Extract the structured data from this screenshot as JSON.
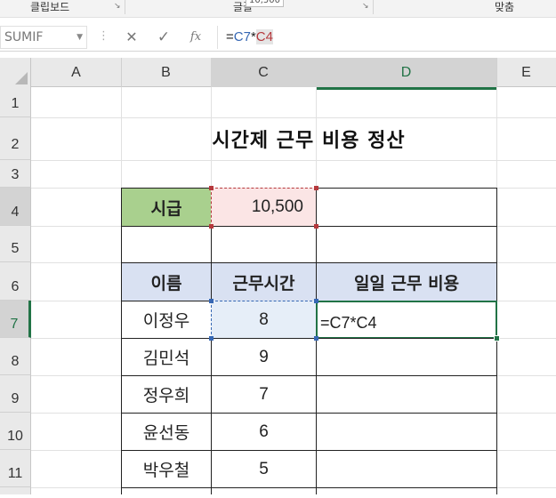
{
  "ribbon": {
    "groups": [
      "클립보드",
      "글꼴",
      "맞춤"
    ],
    "tooltip": "10,500"
  },
  "formula_bar": {
    "name_box": "SUMIF",
    "cancel_icon": "✕",
    "enter_icon": "✓",
    "fx_label": "fx",
    "formula_prefix": "=",
    "formula_ref1": "C7",
    "formula_op": "*",
    "formula_ref2": "C4"
  },
  "columns": [
    "A",
    "B",
    "C",
    "D",
    "E"
  ],
  "rows": [
    "1",
    "2",
    "3",
    "4",
    "5",
    "6",
    "7",
    "8",
    "9",
    "10",
    "11"
  ],
  "sheet": {
    "title": "시간제 근무 비용 정산",
    "wage_label": "시급",
    "wage_value": "10,500",
    "headers": [
      "이름",
      "근무시간",
      "일일 근무 비용"
    ],
    "employees": [
      {
        "name": "이정우",
        "hours": "8",
        "cost": "=C7*C4"
      },
      {
        "name": "김민석",
        "hours": "9",
        "cost": ""
      },
      {
        "name": "정우희",
        "hours": "7",
        "cost": ""
      },
      {
        "name": "윤선동",
        "hours": "6",
        "cost": ""
      },
      {
        "name": "박우철",
        "hours": "5",
        "cost": ""
      }
    ]
  },
  "colors": {
    "excel_green": "#217346",
    "wage_label_bg": "#a9d08e",
    "wage_value_bg": "#fbe5e5",
    "header_bg": "#d9e1f2",
    "ref_blue": "#3667b3",
    "ref_red": "#b5383c"
  }
}
